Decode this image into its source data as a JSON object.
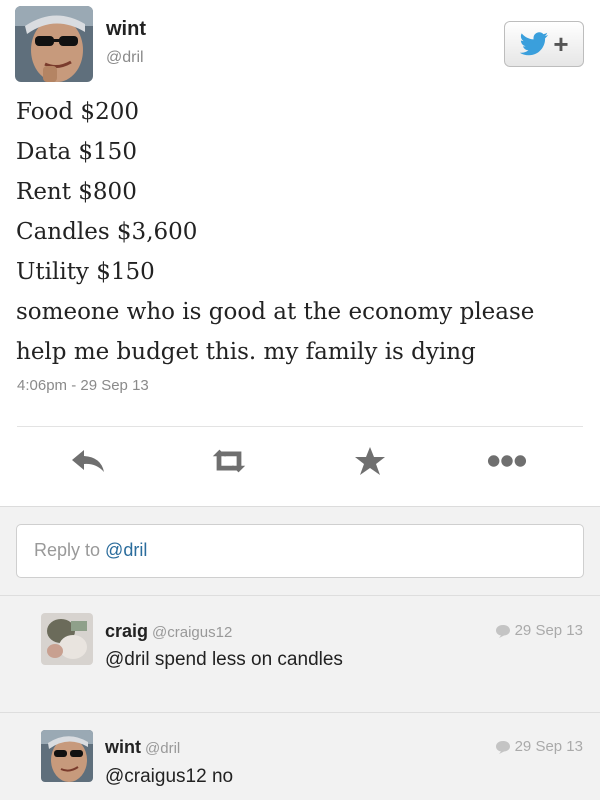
{
  "tweet": {
    "name": "wint",
    "handle": "@dril",
    "lines": [
      "Food $200",
      "Data $150",
      "Rent $800",
      "Candles $3,600",
      "Utility $150",
      "someone who is good at the economy please",
      "help me budget this. my family is dying"
    ],
    "timestamp": "4:06pm - 29 Sep 13",
    "follow_plus": "+",
    "actions": [
      "reply-icon",
      "retweet-icon",
      "favorite-icon",
      "more-icon"
    ]
  },
  "reply_box": {
    "prefix": "Reply to ",
    "mention": "@dril"
  },
  "replies": [
    {
      "name": "craig",
      "handle": "@craigus12",
      "text": "@dril spend less on candles",
      "time": "29 Sep 13"
    },
    {
      "name": "wint",
      "handle": "@dril",
      "text": "@craigus12 no",
      "time": "29 Sep 13"
    }
  ],
  "colors": {
    "link": "#2a6c9c",
    "twitter_blue": "#3a9fdc",
    "muted": "#8a8a8a",
    "reply_bg": "#f2f2f2"
  }
}
